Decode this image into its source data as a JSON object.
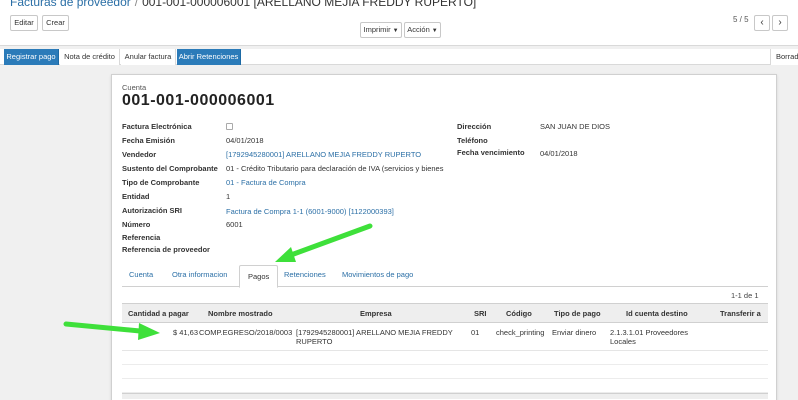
{
  "breadcrumb": {
    "parent": "Facturas de proveedor",
    "separator": "/",
    "current": "001-001-000006001 [ARELLANO MEJIA FREDDY RUPERTO]"
  },
  "toolbar": {
    "edit_label": "Editar",
    "create_label": "Crear",
    "print_label": "Imprimir",
    "action_label": "Acción",
    "pager_text": "5 / 5",
    "prev_icon": "chevron-left-icon",
    "next_icon": "chevron-right-icon"
  },
  "statusbar": {
    "register_payment": "Registrar pago",
    "credit_note": "Nota de crédito",
    "cancel_invoice": "Anular factura",
    "open_withholdings": "Abrir Retenciones",
    "draft_state": "Borrador"
  },
  "form": {
    "account_label": "Cuenta",
    "number_title": "001-001-000006001",
    "fields_left": [
      {
        "label": "Factura Electrónica",
        "value": ""
      },
      {
        "label": "Fecha Emisión",
        "value": "04/01/2018"
      },
      {
        "label": "Vendedor",
        "value": "[1792945280001] ARELLANO MEJIA FREDDY RUPERTO"
      },
      {
        "label": "Sustento del Comprobante",
        "value": "01 - Crédito Tributario para declaración de IVA (servicios y bienes"
      },
      {
        "label": "Tipo de Comprobante",
        "value": "01 - Factura de Compra"
      },
      {
        "label": "Entidad",
        "value": "1"
      },
      {
        "label": "Autorización SRI",
        "value": "Factura de Compra 1-1 (6001-9000) [1122000393]"
      },
      {
        "label": "Número",
        "value": "6001"
      },
      {
        "label": "Referencia",
        "value": ""
      },
      {
        "label": "Referencia de proveedor",
        "value": ""
      }
    ],
    "fields_right": [
      {
        "label": "Dirección",
        "value": "SAN JUAN DE DIOS"
      },
      {
        "label": "Teléfono",
        "value": ""
      },
      {
        "label": "Fecha vencimiento",
        "value": "04/01/2018"
      }
    ]
  },
  "tabs": [
    "Cuenta",
    "Otra informacion",
    "Pagos",
    "Retenciones",
    "Movimientos de pago"
  ],
  "active_tab": "Pagos",
  "payments": {
    "count_text": "1-1 de 1",
    "columns": [
      "Cantidad a pagar",
      "Nombre mostrado",
      "Empresa",
      "SRI",
      "Código",
      "Tipo de pago",
      "Id cuenta destino",
      "Transferir a"
    ],
    "rows": [
      {
        "amount": "$ 41,63",
        "name": "COMP.EGRESO/2018/0003",
        "company": "[1792945280001] ARELLANO MEJIA FREDDY RUPERTO",
        "sri": "01",
        "code": "check_printing",
        "payment_type": "Enviar dinero",
        "destination_account": "2.1.3.1.01 Proveedores Locales",
        "transfer_to": ""
      }
    ]
  },
  "annotations": {
    "arrow_color": "#3ee03a"
  }
}
